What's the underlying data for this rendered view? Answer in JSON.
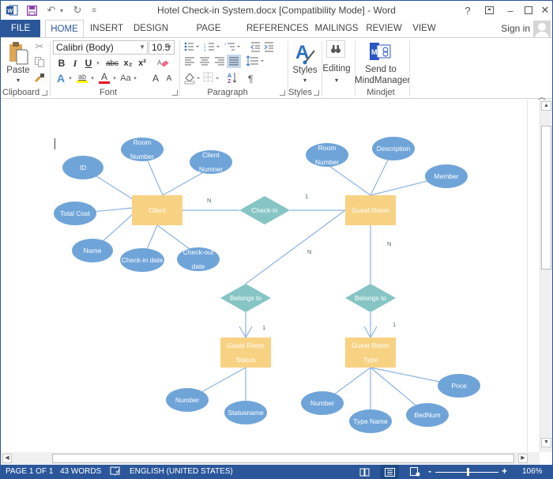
{
  "window": {
    "title": "Hotel Check-in System.docx [Compatibility Mode] - Word",
    "controls": {
      "help": "?",
      "ribbon_options": "⧉",
      "minimize": "–",
      "maximize": "☐",
      "close": "✕"
    }
  },
  "quick_access": {
    "word_icon": "W",
    "save_icon": "💾",
    "undo_icon": "↶",
    "redo_icon": "↻",
    "customize_icon": "⩮"
  },
  "tabs": [
    {
      "label": "FILE"
    },
    {
      "label": "HOME",
      "active": true
    },
    {
      "label": "INSERT"
    },
    {
      "label": "DESIGN"
    },
    {
      "label": "PAGE LAYOUT"
    },
    {
      "label": "REFERENCES"
    },
    {
      "label": "MAILINGS"
    },
    {
      "label": "REVIEW"
    },
    {
      "label": "VIEW"
    }
  ],
  "account": {
    "sign_in": "Sign in"
  },
  "ribbon": {
    "clipboard": {
      "label": "Clipboard",
      "paste": "Paste"
    },
    "font": {
      "label": "Font",
      "font_name": "Calibri (Body)",
      "font_size": "10.5",
      "bold": "B",
      "italic": "I",
      "underline": "U",
      "strike": "abc",
      "subscript": "x₂",
      "superscript": "x²",
      "change_case": "Aa",
      "grow": "A",
      "shrink": "A",
      "font_color": "A",
      "highlight": "ab",
      "highlight_color": "#ffff00",
      "font_color_bar": "#e81123"
    },
    "paragraph": {
      "label": "Paragraph",
      "pilcrow": "¶"
    },
    "styles": {
      "label": "Styles",
      "button": "Styles"
    },
    "editing": {
      "button": "Editing"
    },
    "mindjet": {
      "label": "Mindjet",
      "button_line1": "Send to",
      "button_line2": "MindManager"
    }
  },
  "diagram": {
    "colors": {
      "entity": "#f8d283",
      "attribute": "#6fa4d9",
      "relationship": "#86c5c4",
      "line": "#8db4e2",
      "label": "#4d6a66"
    },
    "entities": [
      {
        "id": "client",
        "lines": [
          "Client"
        ]
      },
      {
        "id": "guest-room",
        "lines": [
          "Guest Room"
        ]
      },
      {
        "id": "guest-room-status",
        "lines": [
          "Guset Room",
          "Status"
        ]
      },
      {
        "id": "guest-room-type",
        "lines": [
          "Guest Room",
          "Type"
        ]
      }
    ],
    "relationships": [
      {
        "id": "check-in",
        "label": "Check-in"
      },
      {
        "id": "belongs-to-status",
        "label": "Belongs to"
      },
      {
        "id": "belongs-to-type",
        "label": "Belongs to"
      }
    ],
    "attributes": [
      {
        "id": "client-id",
        "lines": [
          "ID"
        ]
      },
      {
        "id": "client-room-number",
        "lines": [
          "Room",
          "Number"
        ]
      },
      {
        "id": "client-number",
        "lines": [
          "Client",
          "Numner"
        ]
      },
      {
        "id": "client-total-cost",
        "lines": [
          "Total Cost"
        ]
      },
      {
        "id": "client-name",
        "lines": [
          "Name"
        ]
      },
      {
        "id": "client-checkin-date",
        "lines": [
          "Check-in date"
        ]
      },
      {
        "id": "client-checkout-date",
        "lines": [
          "Check-out",
          "date"
        ]
      },
      {
        "id": "room-room-number",
        "lines": [
          "Room",
          "Number"
        ]
      },
      {
        "id": "room-description",
        "lines": [
          "Description"
        ]
      },
      {
        "id": "room-member",
        "lines": [
          "Member"
        ]
      },
      {
        "id": "status-number",
        "lines": [
          "Number"
        ]
      },
      {
        "id": "status-statusname",
        "lines": [
          "Statusname"
        ]
      },
      {
        "id": "type-number",
        "lines": [
          "Number"
        ]
      },
      {
        "id": "type-type-name",
        "lines": [
          "Type Name"
        ]
      },
      {
        "id": "type-bednum",
        "lines": [
          "BedNum"
        ]
      },
      {
        "id": "type-price",
        "lines": [
          "Price"
        ]
      }
    ],
    "cardinalities": [
      {
        "id": "client-checkin",
        "label": "N"
      },
      {
        "id": "checkin-room",
        "label": "1"
      },
      {
        "id": "room-status",
        "label": "N"
      },
      {
        "id": "room-type",
        "label": "N"
      },
      {
        "id": "status-one",
        "label": "1"
      },
      {
        "id": "type-one",
        "label": "1"
      }
    ]
  },
  "statusbar": {
    "page": "PAGE 1 OF 1",
    "words": "43 WORDS",
    "language": "ENGLISH (UNITED STATES)",
    "zoom_minus": "-",
    "zoom_plus": "+",
    "zoom_level": "106%",
    "zoom_percent": 106
  }
}
